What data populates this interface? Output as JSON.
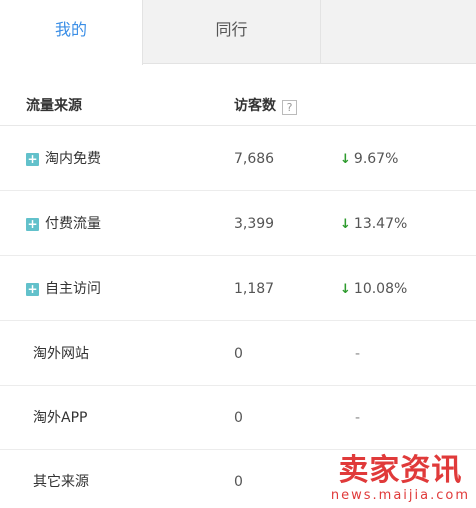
{
  "tabs": [
    {
      "label": "我的",
      "active": true
    },
    {
      "label": "同行",
      "active": false
    }
  ],
  "header": {
    "source_label": "流量来源",
    "visitors_label": "访客数",
    "help_label": "?"
  },
  "rows": [
    {
      "name": "淘内免费",
      "visits": "7,686",
      "change": "9.67%",
      "trend": "down",
      "expandable": true
    },
    {
      "name": "付费流量",
      "visits": "3,399",
      "change": "13.47%",
      "trend": "down",
      "expandable": true
    },
    {
      "name": "自主访问",
      "visits": "1,187",
      "change": "10.08%",
      "trend": "down",
      "expandable": true
    },
    {
      "name": "淘外网站",
      "visits": "0",
      "change": "-",
      "trend": "none",
      "expandable": false
    },
    {
      "name": "淘外APP",
      "visits": "0",
      "change": "-",
      "trend": "none",
      "expandable": false
    },
    {
      "name": "其它来源",
      "visits": "0",
      "change": "",
      "trend": "none",
      "expandable": false
    }
  ],
  "icons": {
    "expand": "+",
    "down_arrow": "↓"
  },
  "watermark": {
    "main": "卖家资讯",
    "sub": "news.maijia.com"
  },
  "colors": {
    "active_tab": "#3a8ee6",
    "expand_icon": "#62c1cb",
    "down_arrow": "#2e9b2e",
    "watermark": "#e03a3a"
  }
}
